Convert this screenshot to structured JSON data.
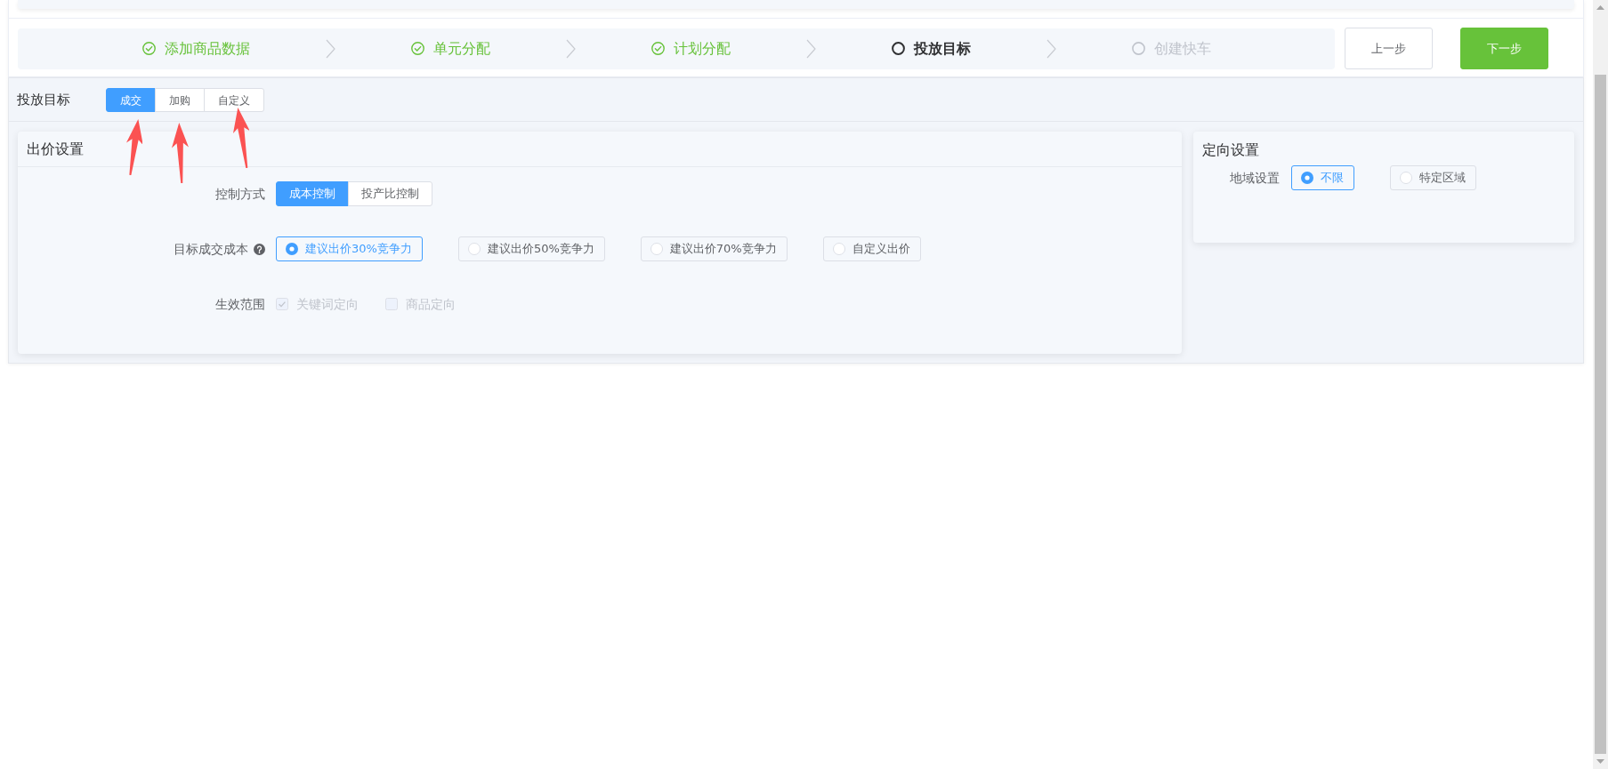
{
  "steps": [
    {
      "label": "添加商品数据",
      "kind": "done"
    },
    {
      "label": "单元分配",
      "kind": "done"
    },
    {
      "label": "计划分配",
      "kind": "done"
    },
    {
      "label": "投放目标",
      "kind": "current"
    },
    {
      "label": "创建快车",
      "kind": "pending"
    }
  ],
  "step_buttons": [
    {
      "label": "上一步",
      "kind": "secondary"
    },
    {
      "label": "下一步",
      "kind": "primary"
    }
  ],
  "delivery_goal": {
    "label": "投放目标",
    "options": [
      {
        "label": "成交",
        "selected": true,
        "annotated": true
      },
      {
        "label": "加购",
        "selected": false,
        "annotated": true
      },
      {
        "label": "自定义",
        "selected": false,
        "annotated": true
      }
    ]
  },
  "bid_settings": {
    "title": "出价设置",
    "fields": [
      {
        "kind": "segmented",
        "label": "控制方式",
        "options": [
          {
            "label": "成本控制",
            "selected": true
          },
          {
            "label": "投产比控制",
            "selected": false
          }
        ]
      },
      {
        "kind": "radio",
        "label": "目标成交成本",
        "help": true,
        "options": [
          {
            "label": "建议出价30%竞争力",
            "selected": true
          },
          {
            "label": "建议出价50%竞争力",
            "selected": false
          },
          {
            "label": "建议出价70%竞争力",
            "selected": false
          },
          {
            "label": "自定义出价",
            "selected": false
          }
        ]
      },
      {
        "kind": "checkbox",
        "label": "生效范围",
        "options": [
          {
            "label": "关键词定向",
            "checked": true,
            "disabled": true
          },
          {
            "label": "商品定向",
            "checked": false,
            "disabled": true
          }
        ]
      }
    ]
  },
  "targeting_settings": {
    "title": "定向设置",
    "fields": [
      {
        "kind": "radio",
        "label": "地域设置",
        "options": [
          {
            "label": "不限",
            "selected": true
          },
          {
            "label": "特定区域",
            "selected": false
          }
        ]
      }
    ]
  }
}
